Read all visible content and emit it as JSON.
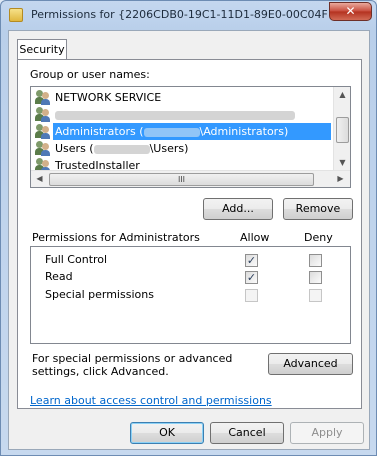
{
  "window": {
    "title": "Permissions for {2206CDB0-19C1-11D1-89E0-00C04F...",
    "close_glyph": "✕"
  },
  "tabs": [
    {
      "label": "Security"
    }
  ],
  "group_list": {
    "label": "Group or user names:",
    "items": [
      {
        "label": "NETWORK SERVICE"
      },
      {
        "label": ""
      },
      {
        "label_prefix": "Administrators (",
        "label_suffix": "\\Administrators)",
        "selected": true
      },
      {
        "label_prefix": "Users (",
        "label_suffix": "\\Users)"
      },
      {
        "label": "TrustedInstaller"
      }
    ],
    "hscroll_thumb_glyph": "III"
  },
  "buttons": {
    "add": "Add...",
    "remove": "Remove",
    "advanced": "Advanced",
    "ok": "OK",
    "cancel": "Cancel",
    "apply": "Apply"
  },
  "permissions": {
    "label": "Permissions for Administrators",
    "col_allow": "Allow",
    "col_deny": "Deny",
    "rows": [
      {
        "name": "Full Control",
        "allow": true,
        "deny": false,
        "disabled": false
      },
      {
        "name": "Read",
        "allow": true,
        "deny": false,
        "disabled": false
      },
      {
        "name": "Special permissions",
        "allow": false,
        "deny": false,
        "disabled": true
      }
    ],
    "check_glyph": "✓"
  },
  "advanced_text": "For special permissions or advanced settings, click Advanced.",
  "link_text": "Learn about access control and permissions",
  "colors": {
    "accent": "#3399ff",
    "link": "#0066cc"
  }
}
